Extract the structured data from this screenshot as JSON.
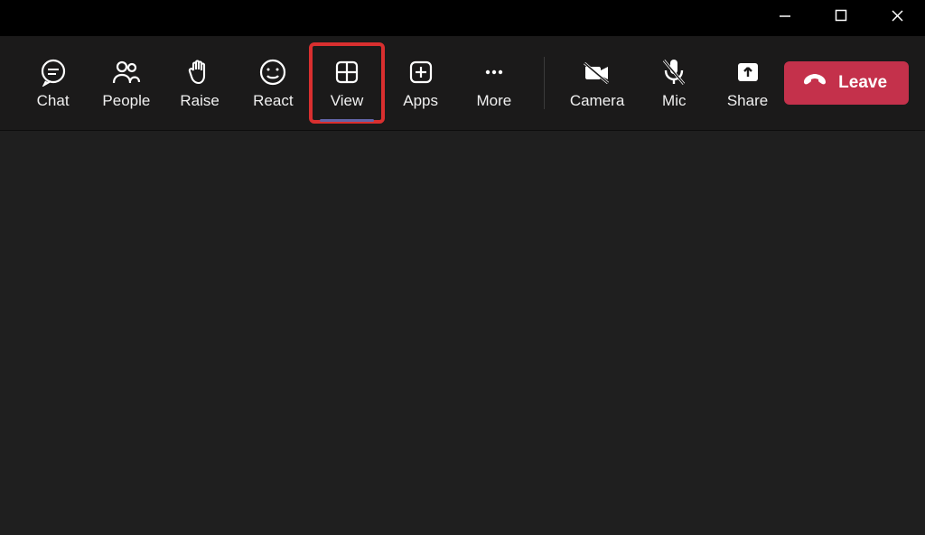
{
  "toolbar": {
    "chat": "Chat",
    "people": "People",
    "raise": "Raise",
    "react": "React",
    "view": "View",
    "apps": "Apps",
    "more": "More",
    "camera": "Camera",
    "mic": "Mic",
    "share": "Share"
  },
  "leave": {
    "label": "Leave"
  },
  "state": {
    "active_button": "View",
    "highlighted_button": "View",
    "camera_off": true,
    "mic_off": true
  }
}
